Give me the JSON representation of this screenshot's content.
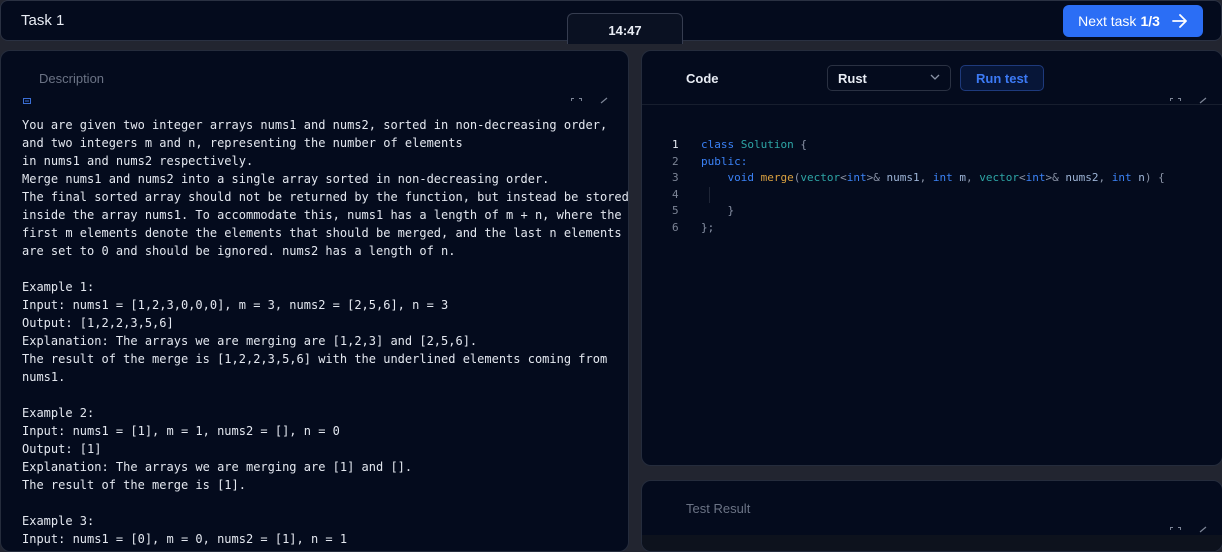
{
  "header": {
    "task_title": "Task 1",
    "timer": "14:47",
    "next_label": "Next task",
    "next_progress": "1/3"
  },
  "description": {
    "tab_label": "Description",
    "lines": [
      "You are given two integer arrays nums1 and nums2, sorted in non-decreasing order,",
      "and two integers m and n, representing the number of elements",
      "in nums1 and nums2 respectively.",
      "Merge nums1 and nums2 into a single array sorted in non-decreasing order.",
      "The final sorted array should not be returned by the function, but instead be stored",
      "inside the array nums1. To accommodate this, nums1 has a length of m + n, where the",
      "first m elements denote the elements that should be merged, and the last n elements",
      "are set to 0 and should be ignored. nums2 has a length of n.",
      "",
      "Example 1:",
      "Input: nums1 = [1,2,3,0,0,0], m = 3, nums2 = [2,5,6], n = 3",
      "Output: [1,2,2,3,5,6]",
      "Explanation: The arrays we are merging are [1,2,3] and [2,5,6].",
      "The result of the merge is [1,2,2,3,5,6] with the underlined elements coming from",
      "nums1.",
      "",
      "Example 2:",
      "Input: nums1 = [1], m = 1, nums2 = [], n = 0",
      "Output: [1]",
      "Explanation: The arrays we are merging are [1] and [].",
      "The result of the merge is [1].",
      "",
      "Example 3:",
      "Input: nums1 = [0], m = 0, nums2 = [1], n = 1"
    ]
  },
  "code": {
    "tab_label": "Code",
    "language": "Rust",
    "run_label": "Run test",
    "line_numbers": [
      "1",
      "2",
      "3",
      "4",
      "5",
      "6"
    ],
    "l1_kw": "class",
    "l1_type": "Solution",
    "l1_brace": " {",
    "l2_kw": "public:",
    "l3_indent": "    ",
    "l3_void": "void",
    "l3_fn": "merge",
    "l3_p1": "(",
    "l3_vec1": "vector",
    "l3_lt1": "<",
    "l3_int1": "int",
    "l3_gt1": ">&",
    "l3_nums1": " nums1",
    "l3_c1": ", ",
    "l3_int2": "int",
    "l3_m": " m",
    "l3_c2": ", ",
    "l3_vec2": "vector",
    "l3_lt2": "<",
    "l3_int3": "int",
    "l3_gt2": ">&",
    "l3_nums2": " nums2",
    "l3_c3": ", ",
    "l3_int4": "int",
    "l3_n": " n",
    "l3_end": ") {",
    "l5_indent": "    ",
    "l5_brace": "}",
    "l6_end": "};"
  },
  "result": {
    "tab_label": "Test Result"
  },
  "colors": {
    "accent": "#2b6ef5",
    "panel_bg": "#040b1d",
    "page_bg": "#222530"
  }
}
